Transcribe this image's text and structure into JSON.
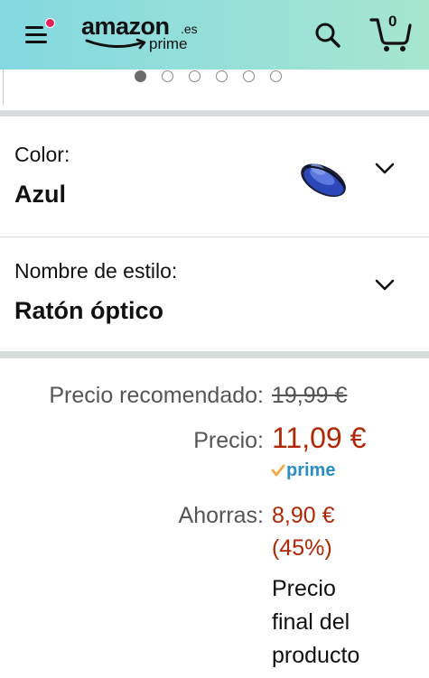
{
  "header": {
    "logo_word": "amazon",
    "logo_tld": ".es",
    "logo_prime": "prime",
    "cart_count": "0",
    "icons": [
      "menu-icon",
      "search-icon",
      "cart-icon"
    ],
    "notification_color": "#e0245e"
  },
  "carousel": {
    "total_slides": 6,
    "active_index": 0
  },
  "variations": {
    "color": {
      "label": "Color:",
      "value": "Azul"
    },
    "style": {
      "label": "Nombre de estilo:",
      "value": "Ratón óptico"
    }
  },
  "pricing": {
    "list_label": "Precio recomendado:",
    "list_price": "19,99 €",
    "price_label": "Precio:",
    "price": "11,09 €",
    "prime_text": "prime",
    "savings_label": "Ahorras:",
    "savings_amount": "8,90 €",
    "savings_percent": "(45%)",
    "final_line1": "Precio",
    "final_line2": "final del",
    "final_line3": "producto"
  },
  "colors": {
    "price_red": "#b12704",
    "prime_blue": "#2a8dc5",
    "header_start": "#84d8e1",
    "header_end": "#a6e6cf"
  }
}
